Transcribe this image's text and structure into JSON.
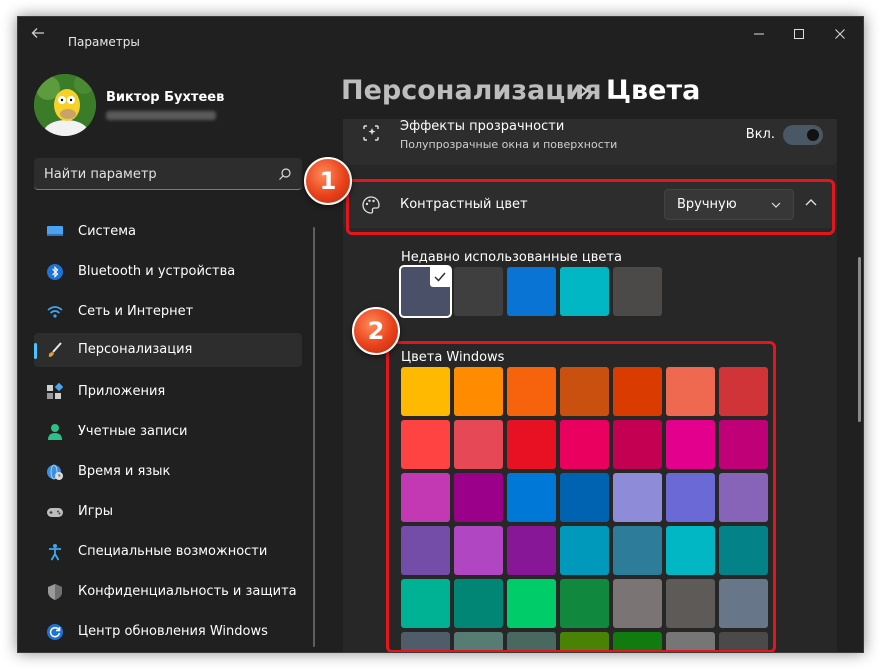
{
  "app": {
    "title": "Параметры"
  },
  "user": {
    "name": "Виктор Бухтеев"
  },
  "search": {
    "placeholder": "Найти параметр"
  },
  "nav": {
    "items": [
      {
        "label": "Система",
        "icon": "monitor-icon",
        "active": false
      },
      {
        "label": "Bluetooth и устройства",
        "icon": "bluetooth-icon",
        "active": false
      },
      {
        "label": "Сеть и Интернет",
        "icon": "wifi-icon",
        "active": false
      },
      {
        "label": "Персонализация",
        "icon": "brush-icon",
        "active": true
      },
      {
        "label": "Приложения",
        "icon": "apps-icon",
        "active": false
      },
      {
        "label": "Учетные записи",
        "icon": "person-icon",
        "active": false
      },
      {
        "label": "Время и язык",
        "icon": "globe-clock-icon",
        "active": false
      },
      {
        "label": "Игры",
        "icon": "gamepad-icon",
        "active": false
      },
      {
        "label": "Специальные возможности",
        "icon": "accessibility-icon",
        "active": false
      },
      {
        "label": "Конфиденциальность и защита",
        "icon": "shield-icon",
        "active": false
      },
      {
        "label": "Центр обновления Windows",
        "icon": "update-icon",
        "active": false
      }
    ]
  },
  "breadcrumb": {
    "parent": "Персонализация",
    "separator": "›",
    "current": "Цвета"
  },
  "transparency": {
    "title": "Эффекты прозрачности",
    "subtitle": "Полупрозрачные окна и поверхности",
    "state_label": "Вкл.",
    "on": true
  },
  "accent": {
    "title": "Контрастный цвет",
    "dropdown_value": "Вручную"
  },
  "recent": {
    "label": "Недавно использованные цвета",
    "colors": [
      "#4a5068",
      "#3f3f3f",
      "#0a74d4",
      "#00b7c3",
      "#4c4a48"
    ],
    "selected_index": 0
  },
  "windows_colors": {
    "label": "Цвета Windows",
    "rows": [
      [
        "#ffb900",
        "#ff8c00",
        "#f7630c",
        "#ca5010",
        "#da3b01",
        "#ef6950",
        "#d13438"
      ],
      [
        "#ff4343",
        "#e74856",
        "#e81123",
        "#ea005e",
        "#c30052",
        "#e3008c",
        "#bf0077"
      ],
      [
        "#c239b3",
        "#9a0089",
        "#0078d7",
        "#0063b1",
        "#8e8cd8",
        "#6b69d6",
        "#8764b8"
      ],
      [
        "#744da9",
        "#b146c2",
        "#881798",
        "#0099bc",
        "#2d7d9a",
        "#00b7c3",
        "#038387"
      ],
      [
        "#00b294",
        "#018574",
        "#00cc6a",
        "#10893e",
        "#7a7574",
        "#5d5a58",
        "#68768a"
      ],
      [
        "#515c6b",
        "#567c73",
        "#486860",
        "#498205",
        "#107c10",
        "#767676",
        "#4c4a48"
      ]
    ]
  },
  "annotations": {
    "badge1": "1",
    "badge2": "2",
    "color": "#e5151e"
  },
  "colors": {
    "accent_blue": "#4cc2ff",
    "window_bg": "#202020",
    "card_bg": "#2d2d2d"
  }
}
